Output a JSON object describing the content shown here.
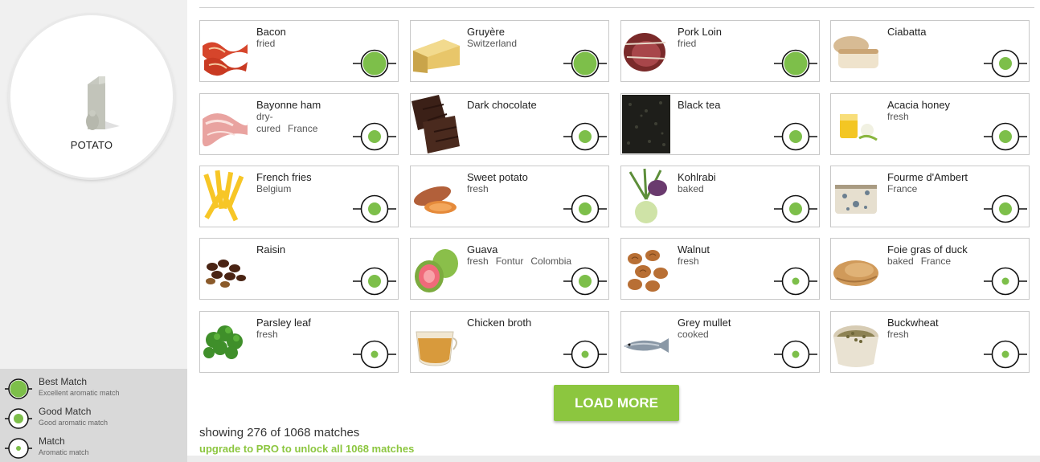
{
  "hero": {
    "label": "POTATO",
    "icon": "potato-carton-icon"
  },
  "legend": [
    {
      "title": "Best Match",
      "subtitle": "Excellent aromatic match",
      "level": "best"
    },
    {
      "title": "Good Match",
      "subtitle": "Good aromatic match",
      "level": "good"
    },
    {
      "title": "Match",
      "subtitle": "Aromatic match",
      "level": "match"
    }
  ],
  "colors": {
    "accent": "#8cc63f",
    "sidebar": "#f0f0f0",
    "legend_bg": "#d9d9d9"
  },
  "cards": [
    {
      "name": "Bacon",
      "tags": [
        "fried"
      ],
      "match": "best",
      "thumb": "bacon"
    },
    {
      "name": "Gruyère",
      "tags": [
        "Switzerland"
      ],
      "match": "best",
      "thumb": "cheese"
    },
    {
      "name": "Pork Loin",
      "tags": [
        "fried"
      ],
      "match": "best",
      "thumb": "pork"
    },
    {
      "name": "Ciabatta",
      "tags": [],
      "match": "good",
      "thumb": "bread"
    },
    {
      "name": "Bayonne ham",
      "tags": [
        "dry-cured",
        "France"
      ],
      "match": "good",
      "thumb": "ham"
    },
    {
      "name": "Dark chocolate",
      "tags": [],
      "match": "good",
      "thumb": "chocolate"
    },
    {
      "name": "Black tea",
      "tags": [],
      "match": "good",
      "thumb": "tea"
    },
    {
      "name": "Acacia honey",
      "tags": [
        "fresh"
      ],
      "match": "good",
      "thumb": "honey"
    },
    {
      "name": "French fries",
      "tags": [
        "Belgium"
      ],
      "match": "good",
      "thumb": "fries"
    },
    {
      "name": "Sweet potato",
      "tags": [
        "fresh"
      ],
      "match": "good",
      "thumb": "sweetpotato"
    },
    {
      "name": "Kohlrabi",
      "tags": [
        "baked"
      ],
      "match": "good",
      "thumb": "kohlrabi"
    },
    {
      "name": "Fourme d'Ambert",
      "tags": [
        "France"
      ],
      "match": "good",
      "thumb": "bluecheese"
    },
    {
      "name": "Raisin",
      "tags": [],
      "match": "good",
      "thumb": "raisin"
    },
    {
      "name": "Guava",
      "tags": [
        "fresh",
        "Fontur",
        "Colombia"
      ],
      "match": "good",
      "thumb": "guava"
    },
    {
      "name": "Walnut",
      "tags": [
        "fresh"
      ],
      "match": "match",
      "thumb": "walnut"
    },
    {
      "name": "Foie gras of duck",
      "tags": [
        "baked",
        "France"
      ],
      "match": "match",
      "thumb": "foiegras"
    },
    {
      "name": "Parsley leaf",
      "tags": [
        "fresh"
      ],
      "match": "match",
      "thumb": "parsley"
    },
    {
      "name": "Chicken broth",
      "tags": [],
      "match": "match",
      "thumb": "broth"
    },
    {
      "name": "Grey mullet",
      "tags": [
        "cooked"
      ],
      "match": "match",
      "thumb": "fish"
    },
    {
      "name": "Buckwheat",
      "tags": [
        "fresh"
      ],
      "match": "match",
      "thumb": "buckwheat"
    }
  ],
  "load_more_label": "LOAD MORE",
  "showing_text": "showing 276 of 1068 matches",
  "upgrade_text": "upgrade to PRO to unlock all 1068 matches"
}
